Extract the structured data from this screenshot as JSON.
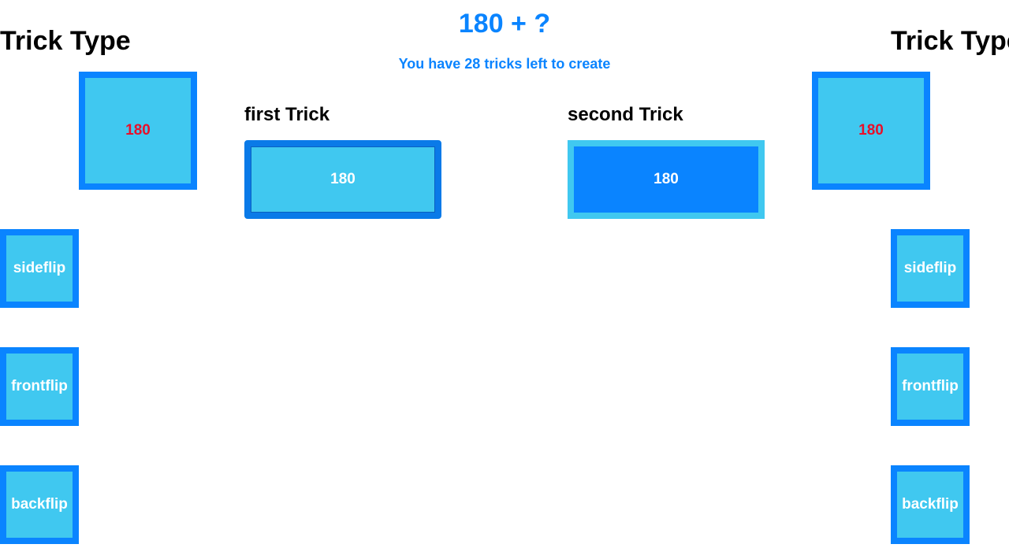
{
  "header": {
    "title": "180 + ?",
    "subtitle": "You have 28 tricks left to create"
  },
  "left_panel": {
    "heading": "Trick Type",
    "selected": "180",
    "options": [
      "sideflip",
      "frontflip",
      "backflip"
    ]
  },
  "right_panel": {
    "heading": "Trick Type",
    "selected": "180",
    "options": [
      "sideflip",
      "frontflip",
      "backflip"
    ]
  },
  "combo": {
    "first_label": "first Trick",
    "first_value": "180",
    "second_label": "second Trick",
    "second_value": "180"
  },
  "colors": {
    "accent": "#0a84ff",
    "tile_fill": "#40c8f0",
    "selected_text": "#e8102a",
    "tile_text": "#ffffff"
  }
}
